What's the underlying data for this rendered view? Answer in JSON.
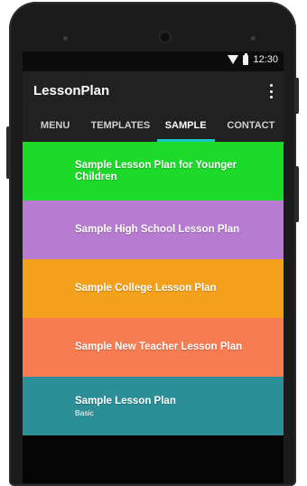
{
  "status": {
    "time": "12:30"
  },
  "app": {
    "title": "LessonPlan"
  },
  "tabs": [
    {
      "label": "MENU"
    },
    {
      "label": "TEMPLATES"
    },
    {
      "label": "SAMPLE"
    },
    {
      "label": "CONTACT"
    }
  ],
  "active_tab": "SAMPLE",
  "cards": [
    {
      "title": "Sample Lesson Plan for Younger Children",
      "subtitle": "",
      "color": "#1cd92a"
    },
    {
      "title": "Sample High School Lesson Plan",
      "subtitle": "",
      "color": "#b77cd1"
    },
    {
      "title": "Sample College Lesson Plan",
      "subtitle": "",
      "color": "#f4a11c"
    },
    {
      "title": "Sample New Teacher Lesson Plan",
      "subtitle": "",
      "color": "#f77c52"
    },
    {
      "title": "Sample Lesson Plan",
      "subtitle": "Basic",
      "color": "#2c8f98"
    }
  ],
  "icons": {
    "wifi": "wifi-icon",
    "battery": "battery-icon",
    "overflow": "overflow-menu-icon"
  }
}
